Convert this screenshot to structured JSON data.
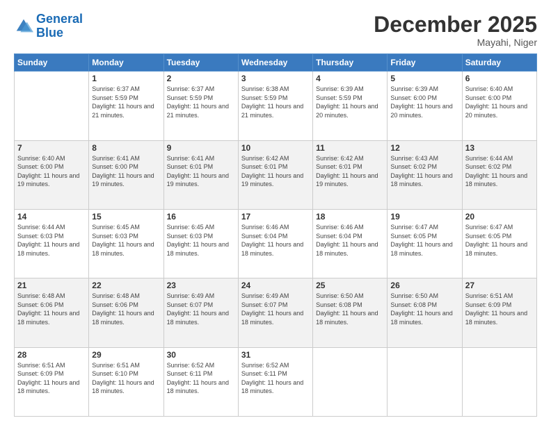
{
  "header": {
    "logo_line1": "General",
    "logo_line2": "Blue",
    "month": "December 2025",
    "location": "Mayahi, Niger"
  },
  "weekdays": [
    "Sunday",
    "Monday",
    "Tuesday",
    "Wednesday",
    "Thursday",
    "Friday",
    "Saturday"
  ],
  "weeks": [
    [
      {
        "day": "",
        "sunrise": "",
        "sunset": "",
        "daylight": ""
      },
      {
        "day": "1",
        "sunrise": "Sunrise: 6:37 AM",
        "sunset": "Sunset: 5:59 PM",
        "daylight": "Daylight: 11 hours and 21 minutes."
      },
      {
        "day": "2",
        "sunrise": "Sunrise: 6:37 AM",
        "sunset": "Sunset: 5:59 PM",
        "daylight": "Daylight: 11 hours and 21 minutes."
      },
      {
        "day": "3",
        "sunrise": "Sunrise: 6:38 AM",
        "sunset": "Sunset: 5:59 PM",
        "daylight": "Daylight: 11 hours and 21 minutes."
      },
      {
        "day": "4",
        "sunrise": "Sunrise: 6:39 AM",
        "sunset": "Sunset: 5:59 PM",
        "daylight": "Daylight: 11 hours and 20 minutes."
      },
      {
        "day": "5",
        "sunrise": "Sunrise: 6:39 AM",
        "sunset": "Sunset: 6:00 PM",
        "daylight": "Daylight: 11 hours and 20 minutes."
      },
      {
        "day": "6",
        "sunrise": "Sunrise: 6:40 AM",
        "sunset": "Sunset: 6:00 PM",
        "daylight": "Daylight: 11 hours and 20 minutes."
      }
    ],
    [
      {
        "day": "7",
        "sunrise": "Sunrise: 6:40 AM",
        "sunset": "Sunset: 6:00 PM",
        "daylight": "Daylight: 11 hours and 19 minutes."
      },
      {
        "day": "8",
        "sunrise": "Sunrise: 6:41 AM",
        "sunset": "Sunset: 6:00 PM",
        "daylight": "Daylight: 11 hours and 19 minutes."
      },
      {
        "day": "9",
        "sunrise": "Sunrise: 6:41 AM",
        "sunset": "Sunset: 6:01 PM",
        "daylight": "Daylight: 11 hours and 19 minutes."
      },
      {
        "day": "10",
        "sunrise": "Sunrise: 6:42 AM",
        "sunset": "Sunset: 6:01 PM",
        "daylight": "Daylight: 11 hours and 19 minutes."
      },
      {
        "day": "11",
        "sunrise": "Sunrise: 6:42 AM",
        "sunset": "Sunset: 6:01 PM",
        "daylight": "Daylight: 11 hours and 19 minutes."
      },
      {
        "day": "12",
        "sunrise": "Sunrise: 6:43 AM",
        "sunset": "Sunset: 6:02 PM",
        "daylight": "Daylight: 11 hours and 18 minutes."
      },
      {
        "day": "13",
        "sunrise": "Sunrise: 6:44 AM",
        "sunset": "Sunset: 6:02 PM",
        "daylight": "Daylight: 11 hours and 18 minutes."
      }
    ],
    [
      {
        "day": "14",
        "sunrise": "Sunrise: 6:44 AM",
        "sunset": "Sunset: 6:03 PM",
        "daylight": "Daylight: 11 hours and 18 minutes."
      },
      {
        "day": "15",
        "sunrise": "Sunrise: 6:45 AM",
        "sunset": "Sunset: 6:03 PM",
        "daylight": "Daylight: 11 hours and 18 minutes."
      },
      {
        "day": "16",
        "sunrise": "Sunrise: 6:45 AM",
        "sunset": "Sunset: 6:03 PM",
        "daylight": "Daylight: 11 hours and 18 minutes."
      },
      {
        "day": "17",
        "sunrise": "Sunrise: 6:46 AM",
        "sunset": "Sunset: 6:04 PM",
        "daylight": "Daylight: 11 hours and 18 minutes."
      },
      {
        "day": "18",
        "sunrise": "Sunrise: 6:46 AM",
        "sunset": "Sunset: 6:04 PM",
        "daylight": "Daylight: 11 hours and 18 minutes."
      },
      {
        "day": "19",
        "sunrise": "Sunrise: 6:47 AM",
        "sunset": "Sunset: 6:05 PM",
        "daylight": "Daylight: 11 hours and 18 minutes."
      },
      {
        "day": "20",
        "sunrise": "Sunrise: 6:47 AM",
        "sunset": "Sunset: 6:05 PM",
        "daylight": "Daylight: 11 hours and 18 minutes."
      }
    ],
    [
      {
        "day": "21",
        "sunrise": "Sunrise: 6:48 AM",
        "sunset": "Sunset: 6:06 PM",
        "daylight": "Daylight: 11 hours and 18 minutes."
      },
      {
        "day": "22",
        "sunrise": "Sunrise: 6:48 AM",
        "sunset": "Sunset: 6:06 PM",
        "daylight": "Daylight: 11 hours and 18 minutes."
      },
      {
        "day": "23",
        "sunrise": "Sunrise: 6:49 AM",
        "sunset": "Sunset: 6:07 PM",
        "daylight": "Daylight: 11 hours and 18 minutes."
      },
      {
        "day": "24",
        "sunrise": "Sunrise: 6:49 AM",
        "sunset": "Sunset: 6:07 PM",
        "daylight": "Daylight: 11 hours and 18 minutes."
      },
      {
        "day": "25",
        "sunrise": "Sunrise: 6:50 AM",
        "sunset": "Sunset: 6:08 PM",
        "daylight": "Daylight: 11 hours and 18 minutes."
      },
      {
        "day": "26",
        "sunrise": "Sunrise: 6:50 AM",
        "sunset": "Sunset: 6:08 PM",
        "daylight": "Daylight: 11 hours and 18 minutes."
      },
      {
        "day": "27",
        "sunrise": "Sunrise: 6:51 AM",
        "sunset": "Sunset: 6:09 PM",
        "daylight": "Daylight: 11 hours and 18 minutes."
      }
    ],
    [
      {
        "day": "28",
        "sunrise": "Sunrise: 6:51 AM",
        "sunset": "Sunset: 6:09 PM",
        "daylight": "Daylight: 11 hours and 18 minutes."
      },
      {
        "day": "29",
        "sunrise": "Sunrise: 6:51 AM",
        "sunset": "Sunset: 6:10 PM",
        "daylight": "Daylight: 11 hours and 18 minutes."
      },
      {
        "day": "30",
        "sunrise": "Sunrise: 6:52 AM",
        "sunset": "Sunset: 6:11 PM",
        "daylight": "Daylight: 11 hours and 18 minutes."
      },
      {
        "day": "31",
        "sunrise": "Sunrise: 6:52 AM",
        "sunset": "Sunset: 6:11 PM",
        "daylight": "Daylight: 11 hours and 18 minutes."
      },
      {
        "day": "",
        "sunrise": "",
        "sunset": "",
        "daylight": ""
      },
      {
        "day": "",
        "sunrise": "",
        "sunset": "",
        "daylight": ""
      },
      {
        "day": "",
        "sunrise": "",
        "sunset": "",
        "daylight": ""
      }
    ]
  ]
}
